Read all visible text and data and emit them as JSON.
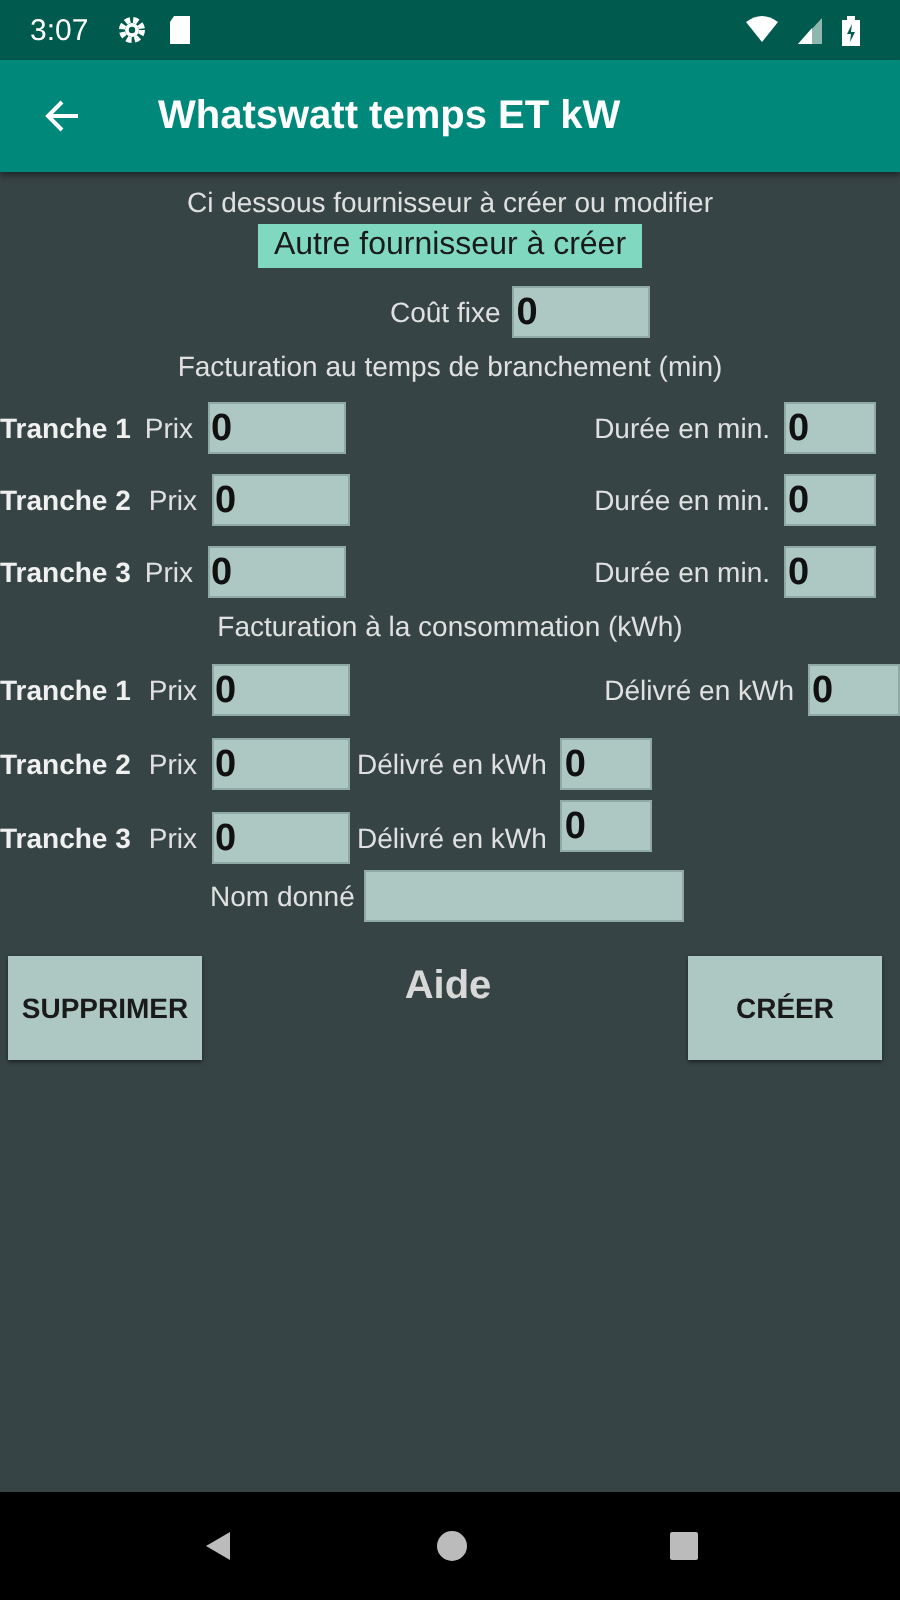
{
  "status_bar": {
    "time": "3:07"
  },
  "app_bar": {
    "title": "Whatswatt temps ET kW"
  },
  "intro": "Ci dessous fournisseur à créer ou modifier",
  "supplier": "Autre fournisseur à créer",
  "fixed_cost": {
    "label": "Coût fixe",
    "value": "0"
  },
  "time_section": {
    "heading": "Facturation au temps de branchement (min)",
    "rows": [
      {
        "label": "Tranche 1",
        "price_label": "Prix",
        "price": "0",
        "amount_label": "Durée en min.",
        "amount": "0"
      },
      {
        "label": "Tranche 2",
        "price_label": "Prix",
        "price": "0",
        "amount_label": "Durée en min.",
        "amount": "0"
      },
      {
        "label": "Tranche 3",
        "price_label": "Prix",
        "price": "0",
        "amount_label": "Durée en min.",
        "amount": "0"
      }
    ]
  },
  "energy_section": {
    "heading": "Facturation à la consommation (kWh)",
    "rows": [
      {
        "label": "Tranche 1",
        "price_label": "Prix",
        "price": "0",
        "amount_label": "Délivré en kWh",
        "amount": "0"
      },
      {
        "label": "Tranche 2",
        "price_label": "Prix",
        "price": "0",
        "amount_label": "Délivré en kWh",
        "amount": "0"
      },
      {
        "label": "Tranche 3",
        "price_label": "Prix",
        "price": "0",
        "amount_label": "Délivré en kWh",
        "amount": "0"
      }
    ]
  },
  "name": {
    "label": "Nom donné"
  },
  "buttons": {
    "delete": "SUPPRIMER",
    "help": "Aide",
    "create": "CRÉER"
  }
}
